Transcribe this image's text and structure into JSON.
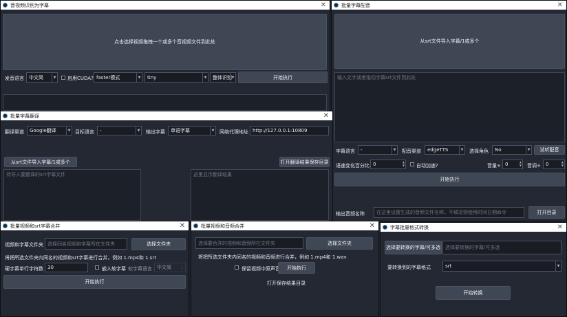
{
  "win1": {
    "title": "音视频识别为字幕",
    "drop_text": "点击选择视频拖拽一个或多个音视频文件到此处",
    "lang_label": "发音语言",
    "lang_value": "中文简",
    "cuda_label": "启用CUDA?",
    "mode_value": "faster模式",
    "model_value": "tiny",
    "split_value": "整体识别",
    "start_label": "开始执行"
  },
  "win2": {
    "title": "批量字幕配音",
    "import_label": "从srt文件导入字幕/1或多个",
    "text_placeholder": "输入文字或者拖动字幕srt文件到此处",
    "sub_lang_label": "字幕语言",
    "sub_lang_value": "-",
    "channel_label": "配音渠道",
    "channel_value": "edgeTTS",
    "role_label": "选择角色",
    "role_value": "No",
    "test_label": "试听配音",
    "speed_label": "语速变化百分比",
    "speed_value": "0",
    "auto_speed_label": "自动加速?",
    "volume_label": "音量+",
    "volume_value": "0",
    "pitch_label": "音调+",
    "pitch_value": "0",
    "start_label": "开始执行",
    "out_label": "输出音频名称",
    "out_placeholder": "在这里设置生成的音频文件名称，不填写则使用时间日期命令",
    "open_label": "打开目录"
  },
  "win3": {
    "title": "批量字幕翻译",
    "channel_label": "翻译渠道",
    "channel_value": "Google翻译",
    "target_label": "目标语言",
    "target_value": "-",
    "output_label": "输出字幕",
    "output_value": "单语字幕",
    "proxy_label": "网络代理地址",
    "proxy_value": "http://127.0.0.1:10809",
    "import_label": "从srt文件导入字幕/1或多个",
    "open_result_label": "打开翻译结果保存目录",
    "source_placeholder": "待导入要翻译的srt字幕文件",
    "result_placeholder": "这里显示翻译结果"
  },
  "win4": {
    "title": "批量视频和srt字幕合并",
    "folder_label": "视频和字幕文件夹",
    "folder_placeholder": "选择同名视频和字幕所在文件夹",
    "choose_label": "选择文件夹",
    "hint": "将把所选文件夹内同名的视频和srt字幕进行合并，例如 1.mp4和 1.srt",
    "maxchars_label": "硬字幕单行字符数",
    "maxchars_value": "30",
    "embed_label": "嵌入软字幕",
    "softlang_label": "软字幕语言",
    "softlang_value": "中文简",
    "start_label": "开始执行"
  },
  "win5": {
    "title": "批量视频和音频合并",
    "folder_placeholder": "选择要合并的视频和音频所在文件夹",
    "choose_label": "选择文件夹",
    "hint": "将把所选文件夹内同名的视频和音频进行合并，例如 1.mp4和 1.wav",
    "keep_label": "保留视频中原声音",
    "start_label": "开始执行",
    "open_label": "打开保存结果目录"
  },
  "win6": {
    "title": "字幕批量格式转换",
    "choose_label": "选择要转换的字幕/可多选",
    "choose_placeholder": "选择要转换的字幕/可多选",
    "format_label": "要转换到的字幕格式",
    "format_value": "srt",
    "start_label": "开始转换"
  }
}
